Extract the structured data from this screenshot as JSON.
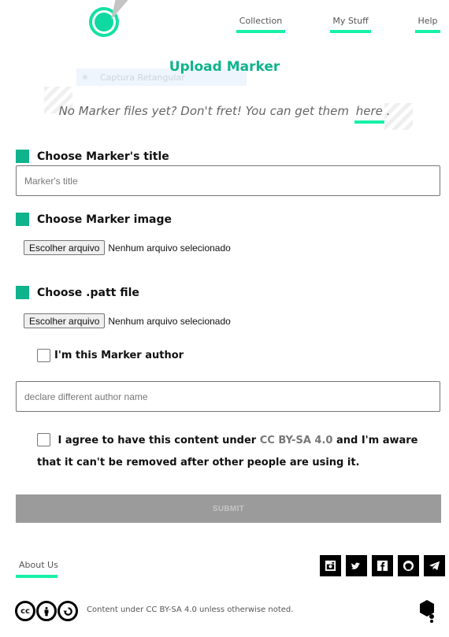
{
  "header": {
    "logo_icon": "location-pin-logo-icon",
    "nav": [
      {
        "label": "Collection"
      },
      {
        "label": "My Stuff"
      },
      {
        "label": "Help"
      }
    ]
  },
  "ghost_tooltip": {
    "label": "Captura Retangular"
  },
  "page": {
    "title": "Upload Marker",
    "info_text": "No Marker files yet? Don't fret! You can get them",
    "info_link": "here",
    "info_end": "."
  },
  "form": {
    "title_section": {
      "label": "Choose Marker's title",
      "placeholder": "Marker's title",
      "value": ""
    },
    "image_section": {
      "label": "Choose Marker image",
      "button": "Escolher arquivo",
      "status": "Nenhum arquivo selecionado"
    },
    "patt_section": {
      "label": "Choose .patt file",
      "button": "Escolher arquivo",
      "status": "Nenhum arquivo selecionado"
    },
    "author_checkbox": {
      "label": "I'm this Marker author",
      "checked": false
    },
    "author_input": {
      "placeholder": "declare different author name",
      "value": ""
    },
    "agree": {
      "before": "I agree to have this content under",
      "license": "CC BY-SA 4.0",
      "after": "and I'm aware that it can't be removed after other people are using it.",
      "checked": false
    },
    "submit_label": "SUBMIT"
  },
  "footer": {
    "about_label": "About Us",
    "social": [
      "instagram-icon",
      "twitter-icon",
      "facebook-icon",
      "github-icon",
      "telegram-icon"
    ],
    "cc_badges": [
      "cc",
      "by",
      "sa"
    ],
    "license_text": "Content under CC BY-SA 4.0 unless otherwise noted.",
    "accent_color": "#17f0a8",
    "brand_color": "#0fb38c"
  }
}
